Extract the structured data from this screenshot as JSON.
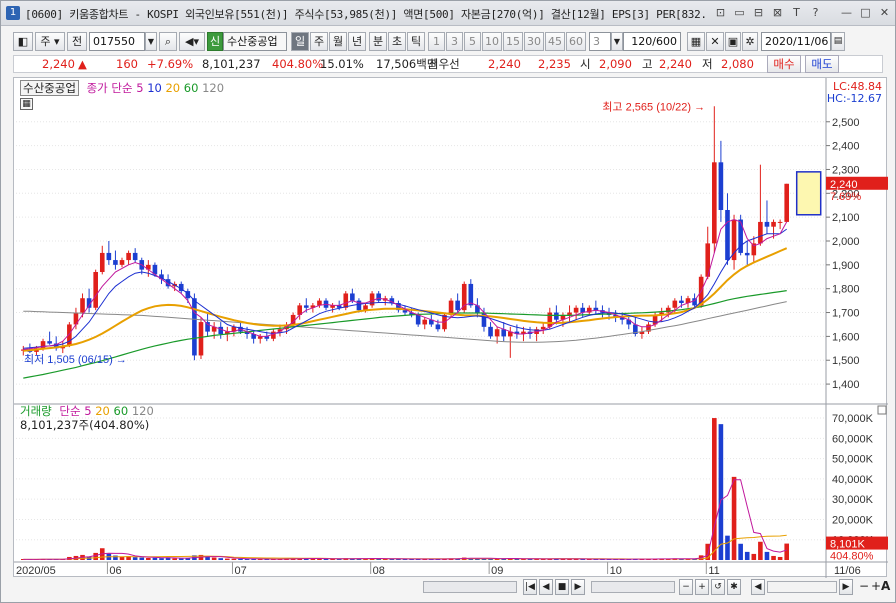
{
  "title": {
    "number": "1",
    "text": "[0600] 키움종합차트 - KOSPI 외국인보유[551(천)] 주식수[53,985(천)] 액면[500] 자본금[270(억)] 결산[12월] EPS[3] PER[832.",
    "buttons": [
      "⊡",
      "▭",
      "⊟",
      "⊠",
      "T",
      "?",
      "—",
      "□",
      "✕"
    ]
  },
  "toolbar": {
    "period_label": "주",
    "prev_label": "전",
    "code": "017550",
    "new_label": "신",
    "stock_name": "수산중공업",
    "tf_buttons": [
      "일",
      "주",
      "월",
      "년",
      "분",
      "초",
      "틱"
    ],
    "tf_selected": "일",
    "numbers": [
      "1",
      "3",
      "5",
      "10",
      "15",
      "30",
      "45",
      "60"
    ],
    "count_value": "3",
    "range": "120/600",
    "date": "2020/11/06"
  },
  "quote": {
    "price": "2,240",
    "arrow": "▲",
    "change": "160",
    "change_pct": "+7.69%",
    "volume": "8,101,237",
    "vol_ratio": "404.80%",
    "turnover": "15.01%",
    "amount": "17,506백만",
    "best_label": "최우선",
    "ask": "2,240",
    "bid": "2,235",
    "open_label": "시",
    "open": "2,090",
    "high_label": "고",
    "high": "2,240",
    "low_label": "저",
    "low": "2,080",
    "buy_label": "매수",
    "sell_label": "매도"
  },
  "price_legend": {
    "name": "수산중공업",
    "ma_label": "종가 단순",
    "ma_periods": [
      "5",
      "10",
      "20",
      "60",
      "120"
    ],
    "lc": "LC:48.84",
    "hc": "HC:-12.67"
  },
  "volume_legend": {
    "label": "거래량",
    "ma_label": "단순",
    "ma_periods": [
      "5",
      "20",
      "60",
      "120"
    ],
    "info": "8,101,237주(404.80%)"
  },
  "annotations": {
    "max_text": "최고 2,565 (10/22)",
    "min_text": "최저 1,505 (06/15)"
  },
  "price_tag": {
    "price": "2,240",
    "pct": "7.69%"
  },
  "volume_tag": {
    "value": "8,101K",
    "pct": "404.80%"
  },
  "date_labels": [
    "2020/05",
    "06",
    "07",
    "08",
    "09",
    "10",
    "11",
    "11/06"
  ],
  "colors": {
    "up": "#e0201b",
    "down": "#1c3fd1",
    "ma5": "#c0189c",
    "ma10": "#1c2fd1",
    "ma20": "#e8a000",
    "ma60": "#1a9a2a",
    "ma120": "#888888"
  },
  "chart_data": {
    "type": "candlestick",
    "price_axis": {
      "ticks": [
        1400,
        1500,
        1600,
        1700,
        1800,
        1900,
        2000,
        2100,
        2200,
        2300,
        2400,
        2500
      ],
      "ylim": [
        1350,
        2650
      ]
    },
    "volume_axis": {
      "ticks": [
        "10,000K",
        "20,000K",
        "30,000K",
        "40,000K",
        "50,000K",
        "60,000K",
        "70,000K"
      ],
      "ylim": [
        0,
        72000
      ]
    },
    "candles": [
      [
        1540,
        1560,
        1520,
        1545,
        300
      ],
      [
        1545,
        1570,
        1530,
        1535,
        320
      ],
      [
        1535,
        1560,
        1520,
        1550,
        280
      ],
      [
        1550,
        1590,
        1540,
        1580,
        500
      ],
      [
        1580,
        1620,
        1565,
        1570,
        420
      ],
      [
        1570,
        1600,
        1540,
        1550,
        330
      ],
      [
        1550,
        1580,
        1530,
        1560,
        300
      ],
      [
        1560,
        1660,
        1555,
        1650,
        1500
      ],
      [
        1650,
        1720,
        1630,
        1700,
        2000
      ],
      [
        1700,
        1780,
        1680,
        1760,
        2500
      ],
      [
        1760,
        1800,
        1700,
        1720,
        1700
      ],
      [
        1720,
        1880,
        1710,
        1870,
        3500
      ],
      [
        1870,
        1980,
        1860,
        1950,
        5800
      ],
      [
        1950,
        2000,
        1900,
        1920,
        3100
      ],
      [
        1920,
        1960,
        1880,
        1900,
        2200
      ],
      [
        1900,
        1930,
        1890,
        1920,
        1600
      ],
      [
        1920,
        1960,
        1900,
        1950,
        1900
      ],
      [
        1950,
        1970,
        1910,
        1920,
        1400
      ],
      [
        1920,
        1930,
        1860,
        1880,
        1200
      ],
      [
        1880,
        1920,
        1850,
        1900,
        1000
      ],
      [
        1900,
        1910,
        1850,
        1860,
        1100
      ],
      [
        1860,
        1880,
        1820,
        1840,
        900
      ],
      [
        1840,
        1860,
        1800,
        1810,
        1300
      ],
      [
        1810,
        1830,
        1790,
        1820,
        800
      ],
      [
        1820,
        1830,
        1780,
        1790,
        700
      ],
      [
        1790,
        1800,
        1740,
        1760,
        900
      ],
      [
        1760,
        1780,
        1500,
        1520,
        2300
      ],
      [
        1520,
        1680,
        1505,
        1660,
        2500
      ],
      [
        1660,
        1700,
        1600,
        1620,
        1600
      ],
      [
        1620,
        1660,
        1590,
        1640,
        1200
      ],
      [
        1640,
        1660,
        1590,
        1610,
        900
      ],
      [
        1610,
        1640,
        1580,
        1620,
        700
      ],
      [
        1620,
        1650,
        1600,
        1640,
        600
      ],
      [
        1640,
        1660,
        1610,
        1620,
        600
      ],
      [
        1620,
        1640,
        1590,
        1610,
        500
      ],
      [
        1610,
        1620,
        1570,
        1590,
        500
      ],
      [
        1590,
        1610,
        1570,
        1600,
        400
      ],
      [
        1600,
        1620,
        1580,
        1590,
        400
      ],
      [
        1590,
        1630,
        1580,
        1620,
        500
      ],
      [
        1620,
        1650,
        1600,
        1630,
        500
      ],
      [
        1630,
        1660,
        1610,
        1650,
        600
      ],
      [
        1650,
        1700,
        1640,
        1690,
        800
      ],
      [
        1690,
        1740,
        1670,
        1730,
        900
      ],
      [
        1730,
        1760,
        1700,
        1720,
        700
      ],
      [
        1720,
        1740,
        1700,
        1730,
        600
      ],
      [
        1730,
        1760,
        1720,
        1750,
        700
      ],
      [
        1750,
        1760,
        1710,
        1720,
        600
      ],
      [
        1720,
        1740,
        1700,
        1730,
        500
      ],
      [
        1730,
        1750,
        1710,
        1720,
        500
      ],
      [
        1720,
        1790,
        1710,
        1780,
        900
      ],
      [
        1780,
        1800,
        1740,
        1750,
        800
      ],
      [
        1750,
        1760,
        1700,
        1710,
        700
      ],
      [
        1710,
        1740,
        1700,
        1730,
        600
      ],
      [
        1730,
        1790,
        1720,
        1780,
        800
      ],
      [
        1780,
        1790,
        1740,
        1750,
        700
      ],
      [
        1750,
        1770,
        1730,
        1760,
        600
      ],
      [
        1760,
        1770,
        1730,
        1740,
        500
      ],
      [
        1740,
        1750,
        1700,
        1710,
        500
      ],
      [
        1710,
        1730,
        1690,
        1700,
        450
      ],
      [
        1700,
        1720,
        1680,
        1690,
        450
      ],
      [
        1690,
        1700,
        1640,
        1650,
        500
      ],
      [
        1650,
        1680,
        1630,
        1670,
        500
      ],
      [
        1670,
        1690,
        1640,
        1650,
        400
      ],
      [
        1650,
        1670,
        1620,
        1630,
        400
      ],
      [
        1630,
        1700,
        1620,
        1690,
        600
      ],
      [
        1690,
        1760,
        1680,
        1750,
        800
      ],
      [
        1750,
        1780,
        1700,
        1710,
        700
      ],
      [
        1710,
        1830,
        1700,
        1820,
        1200
      ],
      [
        1820,
        1840,
        1720,
        1730,
        1000
      ],
      [
        1730,
        1760,
        1680,
        1700,
        700
      ],
      [
        1700,
        1720,
        1620,
        1640,
        700
      ],
      [
        1640,
        1660,
        1590,
        1600,
        800
      ],
      [
        1600,
        1640,
        1570,
        1630,
        600
      ],
      [
        1630,
        1660,
        1580,
        1600,
        600
      ],
      [
        1600,
        1640,
        1510,
        1620,
        900
      ],
      [
        1620,
        1650,
        1590,
        1610,
        700
      ],
      [
        1610,
        1640,
        1580,
        1620,
        500
      ],
      [
        1620,
        1640,
        1590,
        1610,
        500
      ],
      [
        1610,
        1640,
        1580,
        1630,
        500
      ],
      [
        1630,
        1660,
        1610,
        1640,
        500
      ],
      [
        1640,
        1720,
        1630,
        1700,
        700
      ],
      [
        1700,
        1730,
        1650,
        1670,
        600
      ],
      [
        1670,
        1700,
        1640,
        1690,
        500
      ],
      [
        1690,
        1730,
        1660,
        1700,
        500
      ],
      [
        1700,
        1730,
        1670,
        1720,
        500
      ],
      [
        1720,
        1740,
        1680,
        1700,
        500
      ],
      [
        1700,
        1730,
        1690,
        1720,
        400
      ],
      [
        1720,
        1750,
        1690,
        1710,
        400
      ],
      [
        1710,
        1730,
        1680,
        1700,
        400
      ],
      [
        1700,
        1720,
        1670,
        1690,
        400
      ],
      [
        1690,
        1710,
        1660,
        1680,
        400
      ],
      [
        1680,
        1700,
        1650,
        1670,
        400
      ],
      [
        1670,
        1690,
        1630,
        1650,
        400
      ],
      [
        1650,
        1680,
        1600,
        1610,
        500
      ],
      [
        1610,
        1640,
        1590,
        1620,
        500
      ],
      [
        1620,
        1660,
        1610,
        1650,
        500
      ],
      [
        1650,
        1700,
        1640,
        1690,
        600
      ],
      [
        1690,
        1720,
        1660,
        1700,
        600
      ],
      [
        1700,
        1730,
        1680,
        1720,
        600
      ],
      [
        1720,
        1760,
        1700,
        1750,
        800
      ],
      [
        1750,
        1770,
        1720,
        1740,
        600
      ],
      [
        1740,
        1770,
        1720,
        1760,
        600
      ],
      [
        1760,
        1780,
        1720,
        1730,
        700
      ],
      [
        1730,
        1860,
        1720,
        1850,
        2300
      ],
      [
        1850,
        2060,
        1840,
        1990,
        8000
      ],
      [
        1990,
        2565,
        1950,
        2330,
        70000
      ],
      [
        2330,
        2420,
        2080,
        2130,
        67000
      ],
      [
        2130,
        2200,
        1900,
        1920,
        12000
      ],
      [
        1920,
        2110,
        1880,
        2090,
        41000
      ],
      [
        2090,
        2110,
        1940,
        1950,
        8000
      ],
      [
        1950,
        2000,
        1900,
        1940,
        4000
      ],
      [
        1940,
        2020,
        1910,
        1990,
        3000
      ],
      [
        1990,
        2320,
        1980,
        2080,
        9000
      ],
      [
        2080,
        2170,
        2030,
        2060,
        4000
      ],
      [
        2060,
        2090,
        2010,
        2080,
        2000
      ],
      [
        2080,
        2090,
        2050,
        2080,
        1500
      ],
      [
        2080,
        2240,
        2080,
        2240,
        8101
      ]
    ],
    "ma5": [
      1545,
      1548,
      1552,
      1557,
      1560,
      1565,
      1580,
      1610,
      1650,
      1690,
      1730,
      1770,
      1810,
      1840,
      1870,
      1885,
      1900,
      1910,
      1900,
      1880,
      1860,
      1840,
      1820,
      1800,
      1780,
      1750,
      1700,
      1680,
      1650,
      1640,
      1630,
      1620,
      1620,
      1630,
      1620,
      1610,
      1600,
      1600,
      1610,
      1620,
      1640,
      1660,
      1690,
      1710,
      1720,
      1730,
      1735,
      1730,
      1730,
      1740,
      1750,
      1740,
      1740,
      1750,
      1760,
      1755,
      1745,
      1730,
      1715,
      1700,
      1690,
      1680,
      1670,
      1660,
      1660,
      1680,
      1700,
      1730,
      1740,
      1730,
      1700,
      1670,
      1640,
      1630,
      1620,
      1610,
      1610,
      1615,
      1620,
      1625,
      1640,
      1660,
      1670,
      1680,
      1690,
      1700,
      1705,
      1710,
      1705,
      1700,
      1690,
      1680,
      1670,
      1650,
      1640,
      1640,
      1650,
      1670,
      1690,
      1710,
      1730,
      1740,
      1750,
      1790,
      1850,
      1950,
      2050,
      2080,
      2090,
      2080,
      2010,
      1980,
      1990,
      2010,
      2020,
      2030,
      2080
    ],
    "ma10": [
      1550,
      1552,
      1555,
      1558,
      1560,
      1562,
      1568,
      1580,
      1600,
      1630,
      1660,
      1700,
      1740,
      1780,
      1810,
      1830,
      1850,
      1865,
      1870,
      1865,
      1855,
      1845,
      1830,
      1815,
      1800,
      1780,
      1750,
      1730,
      1710,
      1690,
      1670,
      1650,
      1640,
      1635,
      1630,
      1625,
      1620,
      1615,
      1612,
      1615,
      1620,
      1635,
      1650,
      1665,
      1680,
      1695,
      1705,
      1712,
      1718,
      1724,
      1730,
      1735,
      1738,
      1740,
      1742,
      1742,
      1740,
      1735,
      1728,
      1720,
      1712,
      1705,
      1698,
      1690,
      1684,
      1680,
      1678,
      1680,
      1684,
      1686,
      1682,
      1675,
      1666,
      1656,
      1646,
      1638,
      1632,
      1628,
      1626,
      1626,
      1630,
      1640,
      1650,
      1660,
      1670,
      1680,
      1688,
      1694,
      1698,
      1700,
      1698,
      1694,
      1688,
      1680,
      1672,
      1664,
      1660,
      1662,
      1668,
      1678,
      1690,
      1705,
      1720,
      1745,
      1775,
      1820,
      1870,
      1915,
      1950,
      1980,
      2000,
      2010,
      2020,
      2030,
      2030,
      2030,
      2050
    ],
    "ma20": [
      1540,
      1542,
      1545,
      1548,
      1551,
      1554,
      1558,
      1562,
      1568,
      1576,
      1586,
      1598,
      1612,
      1628,
      1645,
      1662,
      1678,
      1694,
      1708,
      1718,
      1726,
      1730,
      1732,
      1731,
      1728,
      1722,
      1714,
      1706,
      1698,
      1690,
      1682,
      1675,
      1668,
      1662,
      1656,
      1652,
      1648,
      1646,
      1645,
      1645,
      1646,
      1648,
      1652,
      1658,
      1664,
      1670,
      1676,
      1682,
      1688,
      1694,
      1700,
      1705,
      1709,
      1712,
      1714,
      1716,
      1716,
      1716,
      1714,
      1712,
      1709,
      1706,
      1703,
      1700,
      1697,
      1694,
      1691,
      1689,
      1688,
      1687,
      1686,
      1684,
      1681,
      1677,
      1673,
      1669,
      1665,
      1662,
      1659,
      1657,
      1656,
      1656,
      1657,
      1659,
      1662,
      1665,
      1668,
      1672,
      1675,
      1678,
      1681,
      1683,
      1685,
      1686,
      1687,
      1687,
      1688,
      1690,
      1693,
      1697,
      1702,
      1710,
      1720,
      1735,
      1755,
      1780,
      1808,
      1836,
      1860,
      1880,
      1896,
      1910,
      1922,
      1934,
      1946,
      1958,
      1970
    ],
    "ma60": [
      1425,
      1430,
      1435,
      1440,
      1446,
      1452,
      1458,
      1464,
      1470,
      1477,
      1484,
      1491,
      1498,
      1506,
      1514,
      1522,
      1530,
      1538,
      1546,
      1553,
      1560,
      1566,
      1572,
      1578,
      1583,
      1588,
      1592,
      1596,
      1600,
      1604,
      1607,
      1610,
      1613,
      1616,
      1619,
      1622,
      1625,
      1628,
      1631,
      1634,
      1637,
      1640,
      1643,
      1646,
      1649,
      1652,
      1655,
      1658,
      1661,
      1664,
      1667,
      1670,
      1673,
      1676,
      1679,
      1682,
      1684,
      1686,
      1688,
      1690,
      1692,
      1693,
      1694,
      1695,
      1696,
      1697,
      1698,
      1698,
      1698,
      1698,
      1698,
      1697,
      1696,
      1695,
      1694,
      1693,
      1692,
      1691,
      1690,
      1689,
      1688,
      1688,
      1688,
      1688,
      1689,
      1690,
      1691,
      1692,
      1693,
      1694,
      1695,
      1696,
      1697,
      1698,
      1699,
      1700,
      1702,
      1704,
      1706,
      1709,
      1712,
      1716,
      1720,
      1725,
      1731,
      1738,
      1745,
      1752,
      1758,
      1763,
      1768,
      1772,
      1776,
      1780,
      1784,
      1788,
      1792
    ],
    "ma120": [
      1705,
      1705,
      1704,
      1703,
      1702,
      1701,
      1700,
      1699,
      1698,
      1697,
      1696,
      1695,
      1694,
      1693,
      1692,
      1691,
      1690,
      1689,
      1688,
      1686,
      1684,
      1682,
      1680,
      1678,
      1676,
      1674,
      1672,
      1670,
      1668,
      1666,
      1664,
      1662,
      1660,
      1658,
      1656,
      1654,
      1652,
      1650,
      1648,
      1646,
      1644,
      1642,
      1640,
      1638,
      1636,
      1634,
      1632,
      1630,
      1628,
      1626,
      1624,
      1622,
      1620,
      1618,
      1616,
      1614,
      1612,
      1610,
      1608,
      1606,
      1604,
      1602,
      1600,
      1598,
      1596,
      1594,
      1592,
      1590,
      1588,
      1586,
      1584,
      1582,
      1580,
      1578,
      1577,
      1576,
      1575,
      1575,
      1575,
      1576,
      1577,
      1578,
      1580,
      1582,
      1584,
      1587,
      1590,
      1593,
      1596,
      1600,
      1604,
      1608,
      1612,
      1616,
      1620,
      1625,
      1630,
      1635,
      1640,
      1645,
      1650,
      1656,
      1662,
      1668,
      1674,
      1680,
      1686,
      1692,
      1698,
      1704,
      1710,
      1716,
      1722,
      1728,
      1734,
      1740,
      1746
    ]
  }
}
